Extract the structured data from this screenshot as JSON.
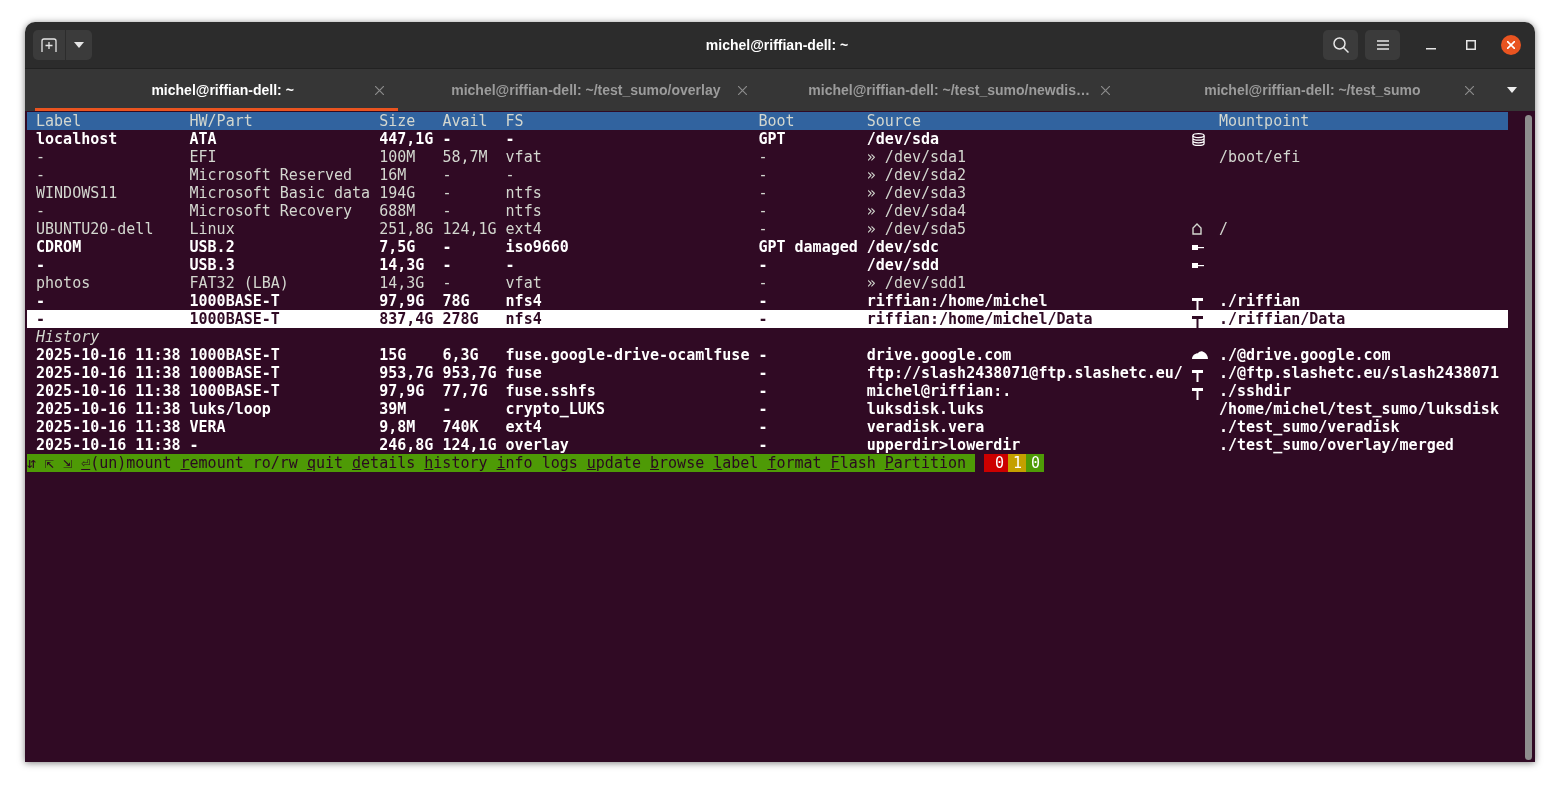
{
  "window": {
    "title": "michel@riffian-dell: ~"
  },
  "tabs": [
    {
      "label": "michel@riffian-dell: ~",
      "selected": true
    },
    {
      "label": "michel@riffian-dell: ~/test_sumo/overlay",
      "selected": false
    },
    {
      "label": "michel@riffian-dell: ~/test_sumo/newdis…",
      "selected": false
    },
    {
      "label": "michel@riffian-dell: ~/test_sumo",
      "selected": false
    }
  ],
  "table": {
    "columns": [
      "Label",
      "HW/Part",
      "Size",
      "Avail",
      "FS",
      "Boot",
      "Source",
      "Mountpoint"
    ],
    "rows": [
      {
        "label": "localhost",
        "hw_part": "ATA",
        "size": "447,1G",
        "avail": "-",
        "fs": "-",
        "boot": "GPT",
        "source": "/dev/sda",
        "kind": "disk",
        "selected": false,
        "children": [
          {
            "label": "-",
            "hw_part": "EFI",
            "size": "100M",
            "avail": "58,7M",
            "fs": "vfat",
            "boot": "-",
            "source": "» /dev/sda1",
            "mountpoint": "/boot/efi",
            "kind": "partition",
            "selected": false
          },
          {
            "label": "-",
            "hw_part": "Microsoft Reserved",
            "size": "16M",
            "avail": "-",
            "fs": "-",
            "boot": "-",
            "source": "» /dev/sda2",
            "kind": "partition",
            "selected": false
          },
          {
            "label": "WINDOWS11",
            "hw_part": "Microsoft Basic data",
            "size": "194G",
            "avail": "-",
            "fs": "ntfs",
            "boot": "-",
            "source": "» /dev/sda3",
            "kind": "partition",
            "selected": false
          },
          {
            "label": "-",
            "hw_part": "Microsoft Recovery",
            "size": "688M",
            "avail": "-",
            "fs": "ntfs",
            "boot": "-",
            "source": "» /dev/sda4",
            "kind": "partition",
            "selected": false
          },
          {
            "label": "UBUNTU20-dell",
            "hw_part": "Linux",
            "size": "251,8G",
            "avail": "124,1G",
            "fs": "ext4",
            "boot": "-",
            "source": "» /dev/sda5",
            "mountpoint": "/",
            "kind": "system",
            "selected": false
          }
        ]
      },
      {
        "label": "CDROM",
        "hw_part": "USB.2",
        "size": "7,5G",
        "avail": "-",
        "fs": "iso9660",
        "boot": "GPT damaged",
        "source": "/dev/sdc",
        "kind": "usb",
        "selected": false
      },
      {
        "label": "-",
        "hw_part": "USB.3",
        "size": "14,3G",
        "avail": "-",
        "fs": "-",
        "boot": "-",
        "source": "/dev/sdd",
        "kind": "usb",
        "selected": false,
        "children": [
          {
            "label": "photos",
            "hw_part": "FAT32 (LBA)",
            "size": "14,3G",
            "avail": "-",
            "fs": "vfat",
            "boot": "-",
            "source": "» /dev/sdd1",
            "kind": "partition",
            "selected": false
          }
        ]
      },
      {
        "label": "-",
        "hw_part": "1000BASE-T",
        "size": "97,9G",
        "avail": "78G",
        "fs": "nfs4",
        "boot": "-",
        "source": "riffian:/home/michel",
        "mountpoint": "./riffian",
        "kind": "network",
        "selected": false
      },
      {
        "label": "-",
        "hw_part": "1000BASE-T",
        "size": "837,4G",
        "avail": "278G",
        "fs": "nfs4",
        "boot": "-",
        "source": "riffian:/home/michel/Data",
        "mountpoint": "./riffian/Data",
        "kind": "network",
        "selected": true
      }
    ]
  },
  "history": {
    "title": "History",
    "rows": [
      {
        "time": "2025-10-16 11:38",
        "hw_part": "1000BASE-T",
        "size": "15G",
        "avail": "6,3G",
        "fs": "fuse.google-drive-ocamlfuse",
        "boot": "-",
        "source": "drive.google.com",
        "mountpoint": "./@drive.google.com",
        "kind": "cloud",
        "selected": false
      },
      {
        "time": "2025-10-16 11:38",
        "hw_part": "1000BASE-T",
        "size": "953,7G",
        "avail": "953,7G",
        "fs": "fuse",
        "boot": "-",
        "source": "ftp://slash2438071@ftp.slashetc.eu/",
        "mountpoint": "./@ftp.slashetc.eu/slash2438071",
        "kind": "network",
        "selected": false
      },
      {
        "time": "2025-10-16 11:38",
        "hw_part": "1000BASE-T",
        "size": "97,9G",
        "avail": "77,7G",
        "fs": "fuse.sshfs",
        "boot": "-",
        "source": "michel@riffian:.",
        "mountpoint": "./sshdir",
        "kind": "network",
        "selected": false
      },
      {
        "time": "2025-10-16 11:38",
        "hw_part": "luks/loop",
        "size": "39M",
        "avail": "-",
        "fs": "crypto_LUKS",
        "boot": "-",
        "source": "luksdisk.luks",
        "mountpoint": "/home/michel/test_sumo/luksdisk",
        "kind": "file",
        "selected": false
      },
      {
        "time": "2025-10-16 11:38",
        "hw_part": "VERA",
        "size": "9,8M",
        "avail": "740K",
        "fs": "ext4",
        "boot": "-",
        "source": "veradisk.vera",
        "mountpoint": "./test_sumo/veradisk",
        "kind": "file",
        "selected": false
      },
      {
        "time": "2025-10-16 11:38",
        "hw_part": "-",
        "size": "246,8G",
        "avail": "124,1G",
        "fs": "overlay",
        "boot": "-",
        "source": "upperdir>lowerdir",
        "mountpoint": "./test_sumo/overlay/merged",
        "kind": "file",
        "selected": false
      }
    ]
  },
  "status_bar": {
    "nav_keys": "⇵⇱⇲",
    "commands": [
      {
        "text": "⏎(un)mount",
        "hotkey": true
      },
      {
        "text": "remount",
        "hotkey": true
      },
      {
        "text": "ro/rw",
        "hotkey": false
      },
      {
        "text": "quit",
        "hotkey": true
      },
      {
        "text": "details",
        "hotkey": true
      },
      {
        "text": "history",
        "hotkey": true
      },
      {
        "text": "info",
        "hotkey": true
      },
      {
        "text": "logs",
        "hotkey": false
      },
      {
        "text": "update",
        "hotkey": true
      },
      {
        "text": "browse",
        "hotkey": true
      },
      {
        "text": "label",
        "hotkey": true
      },
      {
        "text": "format",
        "hotkey": true
      },
      {
        "text": "Flash",
        "hotkey": true
      },
      {
        "text": "Partition",
        "hotkey": true
      }
    ],
    "counters": [
      {
        "text": "0",
        "color": "#cc0000"
      },
      {
        "text": "1",
        "color": "#c4a000"
      },
      {
        "text": "0",
        "color": "#4e9a06"
      }
    ]
  }
}
